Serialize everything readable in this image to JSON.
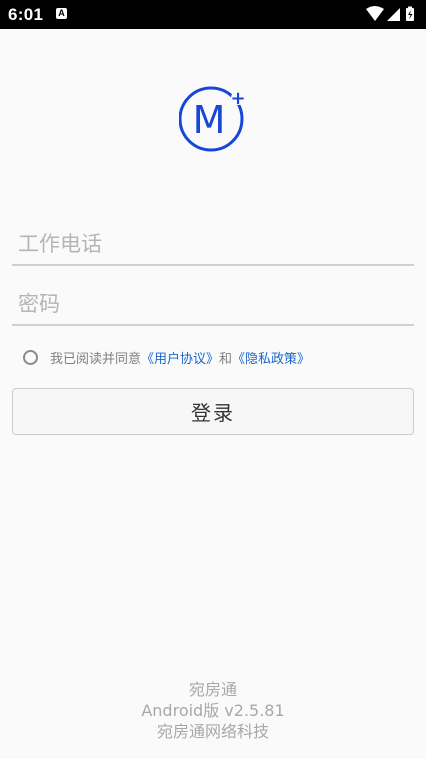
{
  "status_bar": {
    "time": "6:01",
    "notification_icon": "A"
  },
  "logo": {
    "letter": "M",
    "plus": "+",
    "color": "#1847d8"
  },
  "form": {
    "phone_placeholder": "工作电话",
    "password_placeholder": "密码"
  },
  "agreement": {
    "prefix": "我已阅读并同意",
    "user_agreement": "《用户协议》",
    "conjunction": "和",
    "privacy_policy": "《隐私政策》",
    "link_color": "#1a66c9"
  },
  "login_button": {
    "label": "登录"
  },
  "footer": {
    "app_name": "宛房通",
    "version": "Android版  v2.5.81",
    "company": "宛房通网络科技"
  },
  "colors": {
    "background": "#fafafa",
    "status_bar": "#000000",
    "text_muted": "#a8a8a8"
  }
}
